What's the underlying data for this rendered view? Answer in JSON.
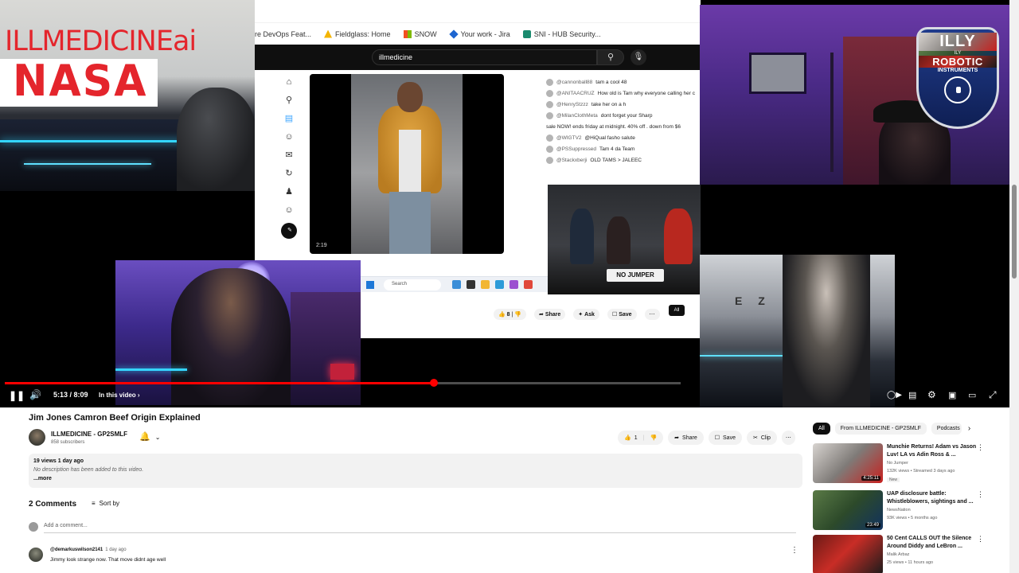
{
  "overlay": {
    "brand_text": "ILLMEDICINEai",
    "nasa_text": "NASA",
    "badge": {
      "top": "ILLY",
      "small": "ILY",
      "mid": "ROBOTIC",
      "bottom": "INSTRUMENTS"
    },
    "studio_sign": "E Z",
    "podcast_logo": "NO JUMPER"
  },
  "screen_share": {
    "bookmarks": [
      {
        "label": "re DevOps Feat...",
        "color": "#4285f4"
      },
      {
        "label": "Fieldglass: Home",
        "color": "#f4b400"
      },
      {
        "label": "SNOW",
        "color": "#2e7d32"
      },
      {
        "label": "Your work - Jira",
        "color": "#1e66d0"
      },
      {
        "label": "SNI - HUB Security...",
        "color": "#1a8a6e"
      }
    ],
    "search_value": "illmedicine",
    "video_time": "2:19",
    "chat": [
      {
        "name": "@cannonball88",
        "text": "tam a cool 48"
      },
      {
        "name": "@ANITAACRUZ",
        "text": "How old is Tam why everyone calling her c"
      },
      {
        "name": "@HenryStzzz",
        "text": "take her on a h"
      },
      {
        "name": "@MilanClothMeta",
        "text": "dont forget your Sharp"
      },
      {
        "name": "",
        "text": "sale NOW! ends friday at midnight. 40% off . down from $6"
      },
      {
        "name": "@WIGTV2",
        "text": "@HiQual fasho salute"
      },
      {
        "name": "@PSSuppressed",
        "text": "Tam 4 da Team"
      },
      {
        "name": "@Stackxberji",
        "text": "OLD TAMS > JALEEC"
      }
    ],
    "taskbar_search": "Search",
    "actions": [
      "8",
      "",
      "Share",
      "Ask",
      "Save",
      "⋯"
    ],
    "filter_all": "All"
  },
  "player": {
    "current_time": "5:13",
    "duration": "8:09",
    "chapter": "In this video",
    "progress": 0.6345
  },
  "video": {
    "title": "Jim Jones Camron Beef Origin Explained",
    "channel": "ILLMEDICINE - GP2SMLF",
    "subscribers": "858 subscribers",
    "likes": "1",
    "share_label": "Share",
    "save_label": "Save",
    "clip_label": "Clip",
    "views_date": "19 views  1 day ago",
    "description": "No description has been added to this video.",
    "more": "...more"
  },
  "comments": {
    "count_label": "2 Comments",
    "sort_label": "Sort by",
    "add_placeholder": "Add a comment...",
    "items": [
      {
        "author": "@demarkuswilson2141",
        "age": "1 day ago",
        "text": "Jimmy look strange now. That move didnt age well"
      }
    ]
  },
  "sidebar": {
    "chips": [
      "All",
      "From ILLMEDICINE - GP2SMLF",
      "Podcasts"
    ],
    "recommendations": [
      {
        "title": "Munchie Returns! Adam vs Jason Luv! LA vs Adin Ross & ...",
        "channel": "No Jumper",
        "meta": "132K views • Streamed 3 days ago",
        "badge": "New",
        "duration": "4:25:11"
      },
      {
        "title": "UAP disclosure battle: Whistleblowers, sightings and ...",
        "channel": "NewsNation",
        "meta": "93K views • 5 months ago",
        "badge": "",
        "duration": "23:49"
      },
      {
        "title": "50 Cent CALLS OUT the Silence Around Diddy and LeBron ...",
        "channel": "Malik Arbaz",
        "meta": "25 views • 11 hours ago",
        "badge": "",
        "duration": ""
      }
    ]
  }
}
